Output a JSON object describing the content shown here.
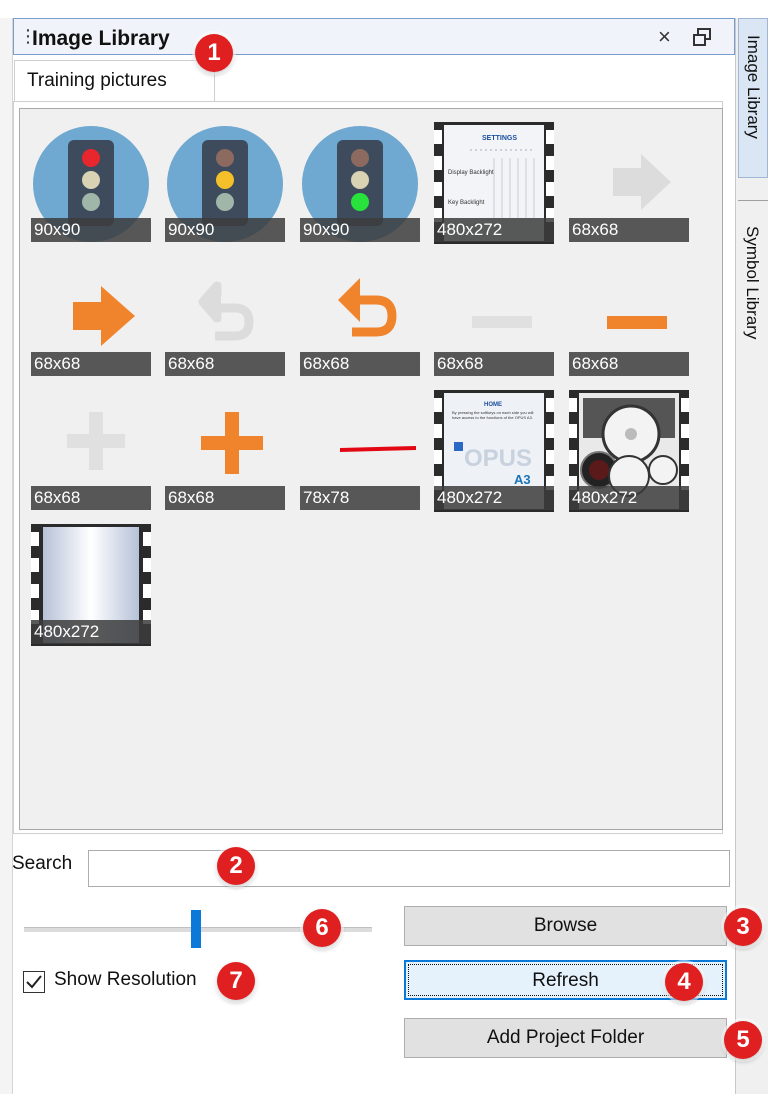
{
  "panel": {
    "title": "Image Library",
    "close_icon": "close-icon",
    "float_icon": "float-window-icon",
    "tab_label": "Training pictures"
  },
  "side_tabs": [
    "Image Library",
    "Symbol Library"
  ],
  "gallery": {
    "items": [
      {
        "icon": "traffic-light-red-icon",
        "resolution": "90x90"
      },
      {
        "icon": "traffic-light-yellow-icon",
        "resolution": "90x90"
      },
      {
        "icon": "traffic-light-green-icon",
        "resolution": "90x90"
      },
      {
        "icon": "settings-screen-thumbnail",
        "resolution": "480x272"
      },
      {
        "icon": "arrow-right-gray-icon",
        "resolution": "68x68"
      },
      {
        "icon": "arrow-right-orange-icon",
        "resolution": "68x68"
      },
      {
        "icon": "undo-gray-icon",
        "resolution": "68x68"
      },
      {
        "icon": "undo-orange-icon",
        "resolution": "68x68"
      },
      {
        "icon": "minus-gray-icon",
        "resolution": "68x68"
      },
      {
        "icon": "minus-orange-icon",
        "resolution": "68x68"
      },
      {
        "icon": "plus-gray-icon",
        "resolution": "68x68"
      },
      {
        "icon": "plus-orange-icon",
        "resolution": "68x68"
      },
      {
        "icon": "needle-red-icon",
        "resolution": "78x78"
      },
      {
        "icon": "home-screen-thumbnail",
        "resolution": "480x272"
      },
      {
        "icon": "gauge-screen-thumbnail",
        "resolution": "480x272"
      },
      {
        "icon": "blank-frame-thumbnail",
        "resolution": "480x272"
      }
    ],
    "screen_texts": {
      "settings_title": "SETTINGS",
      "settings_line1": "Display Backlight",
      "settings_line2": "Key Backlight",
      "home_title": "HOME",
      "home_body": "By pressing the softkeys on each side you will have access to the functions of the OPUS A3.",
      "home_logo": "OPUS",
      "home_logo_sub": "A3"
    }
  },
  "search": {
    "label": "Search",
    "value": ""
  },
  "slider": {
    "level": 0.49
  },
  "buttons": {
    "browse": "Browse",
    "refresh": "Refresh",
    "add_folder": "Add Project Folder"
  },
  "show_resolution": {
    "label": "Show Resolution",
    "checked": true
  },
  "callouts": [
    "1",
    "2",
    "3",
    "4",
    "5",
    "6",
    "7"
  ],
  "colors": {
    "accent": "#0a79d8",
    "callout": "#e02020",
    "orange": "#f0842c",
    "tile_label_bg": "#3c3c3c"
  }
}
